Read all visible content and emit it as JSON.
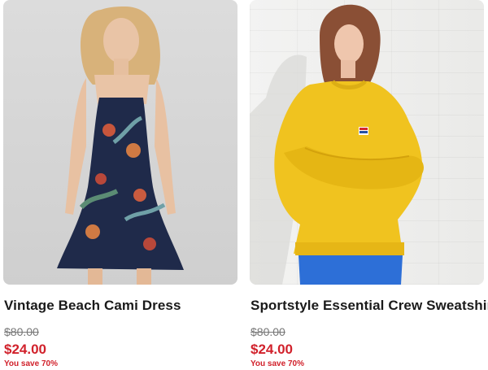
{
  "products": [
    {
      "name": "Vintage Beach Cami Dress",
      "was_price": "$80.00",
      "price": "$24.00",
      "savings": "You save 70%",
      "image_alt": "Model wearing navy floral cami dress"
    },
    {
      "name": "Sportstyle Essential Crew Sweatshirt",
      "was_price": "$80.00",
      "price": "$24.00",
      "savings": "You save 70%",
      "image_alt": "Model wearing yellow crew sweatshirt"
    }
  ],
  "colors": {
    "sale_red": "#d1212b",
    "text_dark": "#1a1a1a",
    "strike_grey": "#777777"
  }
}
